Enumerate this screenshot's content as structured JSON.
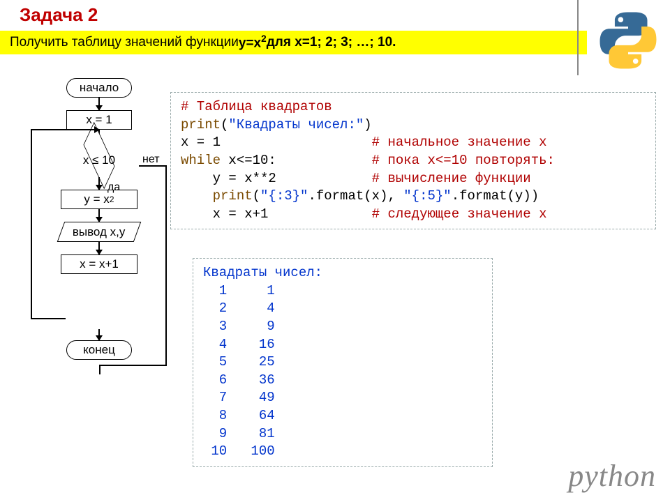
{
  "title": "Задача 2",
  "task": {
    "prefix": "Получить таблицу значений функции ",
    "func_pre": "y=x",
    "func_sup": "2",
    "suffix": " для x=1; 2; 3; …; 10."
  },
  "flowchart": {
    "start": "начало",
    "init": "x = 1",
    "cond": "x ≤ 10",
    "yes": "да",
    "no": "нет",
    "calc_pre": "y = x",
    "calc_sup": "2",
    "output": "вывод x,y",
    "incr": "x = x+1",
    "end": "конец"
  },
  "code": {
    "l1_comment": "# Таблица квадратов",
    "l2_kw": "print",
    "l2_paren_open": "(",
    "l2_str": "\"Квадраты чисел:\"",
    "l2_paren_close": ")",
    "l3_stmt": "x = 1",
    "l3_pad": "                   ",
    "l3_comment": "# начальное значение x",
    "l4_kw": "while",
    "l4_cond": " x<=10:",
    "l4_pad": "            ",
    "l4_comment": "# пока x<=10 повторять:",
    "l5_indent": "    ",
    "l5_stmt": "y = x**2",
    "l5_pad": "            ",
    "l5_comment": "# вычисление функции",
    "l6_indent": "    ",
    "l6_kw": "print",
    "l6_paren_open": "(",
    "l6_str1": "\"{:3}\"",
    "l6_mid1": ".format(x), ",
    "l6_str2": "\"{:5}\"",
    "l6_mid2": ".format(y))",
    "l7_indent": "    ",
    "l7_stmt": "x = x+1",
    "l7_pad": "             ",
    "l7_comment": "# следующее значение x"
  },
  "output": {
    "header": "Квадраты чисел:",
    "rows": [
      "  1     1",
      "  2     4",
      "  3     9",
      "  4    16",
      "  5    25",
      "  6    36",
      "  7    49",
      "  8    64",
      "  9    81",
      " 10   100"
    ]
  },
  "branding": "python"
}
